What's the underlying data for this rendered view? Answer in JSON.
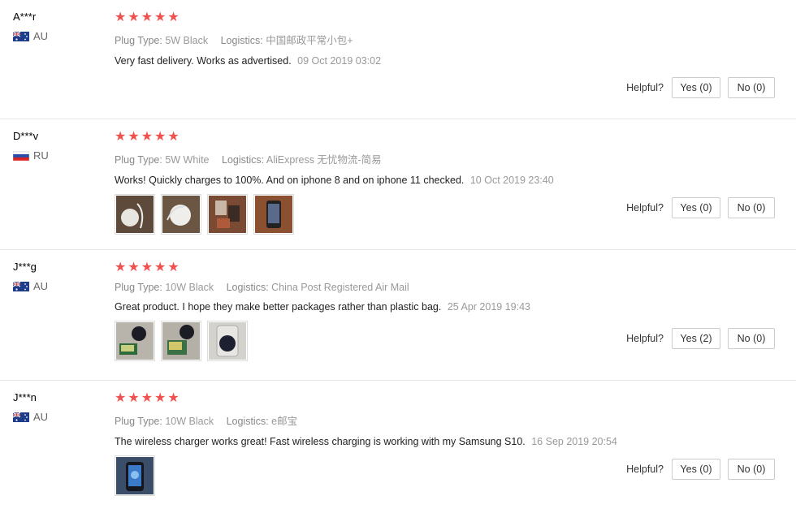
{
  "ui": {
    "plug_label": "Plug Type:",
    "logistics_label": "Logistics:",
    "helpful_label": "Helpful?"
  },
  "reviews": [
    {
      "user": "A***r",
      "country": "AU",
      "stars": "★★★★★",
      "plug": "5W Black",
      "logistics": "中国邮政平常小包+",
      "text": "Very fast delivery. Works as advertised.",
      "date": "09 Oct 2019 03:02",
      "yes": "Yes (0)",
      "no": "No (0)"
    },
    {
      "user": "D***v",
      "country": "RU",
      "stars": "★★★★★",
      "plug": "5W White",
      "logistics": "AliExpress 无忧物流-简易",
      "text": "Works! Quickly charges to 100%. And on iphone 8 and on iphone 11 checked.",
      "date": "10 Oct 2019 23:40",
      "yes": "Yes (0)",
      "no": "No (0)"
    },
    {
      "user": "J***g",
      "country": "AU",
      "stars": "★★★★★",
      "plug": "10W Black",
      "logistics": "China Post Registered Air Mail",
      "text": "Great product. I hope they make better packages rather than plastic bag.",
      "date": "25 Apr 2019 19:43",
      "yes": "Yes (2)",
      "no": "No (0)"
    },
    {
      "user": "J***n",
      "country": "AU",
      "stars": "★★★★★",
      "plug": "10W Black",
      "logistics": "e邮宝",
      "text": "The wireless charger works great! Fast wireless charging is working with my Samsung S10.",
      "date": "16 Sep 2019 20:54",
      "yes": "Yes (0)",
      "no": "No (0)"
    }
  ]
}
